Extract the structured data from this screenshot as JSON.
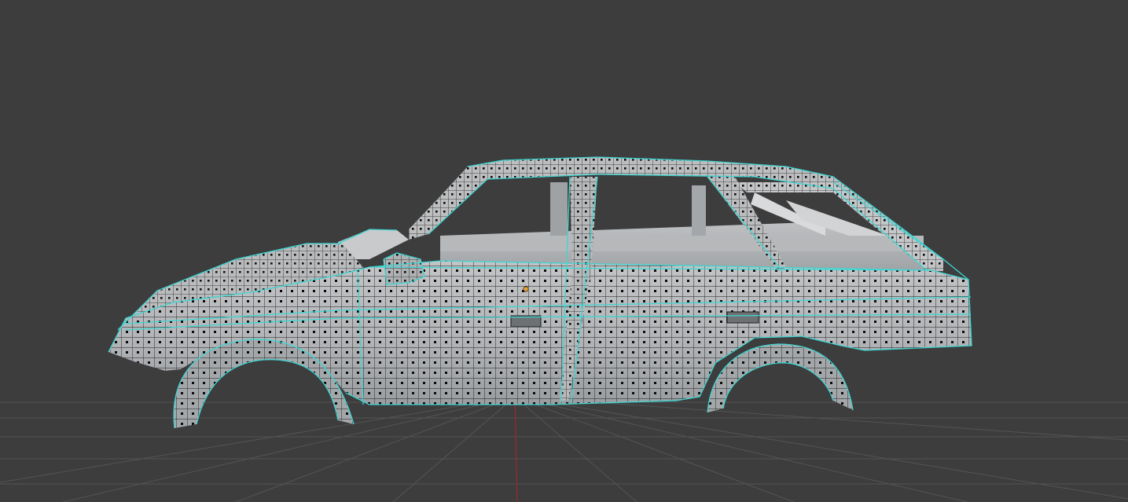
{
  "viewport": {
    "background": "#3d3d3d",
    "grid_color": "#545454",
    "y_axis_color": "#9a2a2a",
    "mesh_fill": "#b4b6b8",
    "mesh_shadow": "#8e9194",
    "interior_fill": "#a8abad",
    "wire_color": "#1b1b1b",
    "selected_edge_color": "#3ed6d2",
    "vertex_color": "#0a0a0a",
    "origin_color": "#e8a13a"
  },
  "scene": {
    "object": "car-body-mesh",
    "mode": "edit-mode",
    "selection": "all"
  }
}
